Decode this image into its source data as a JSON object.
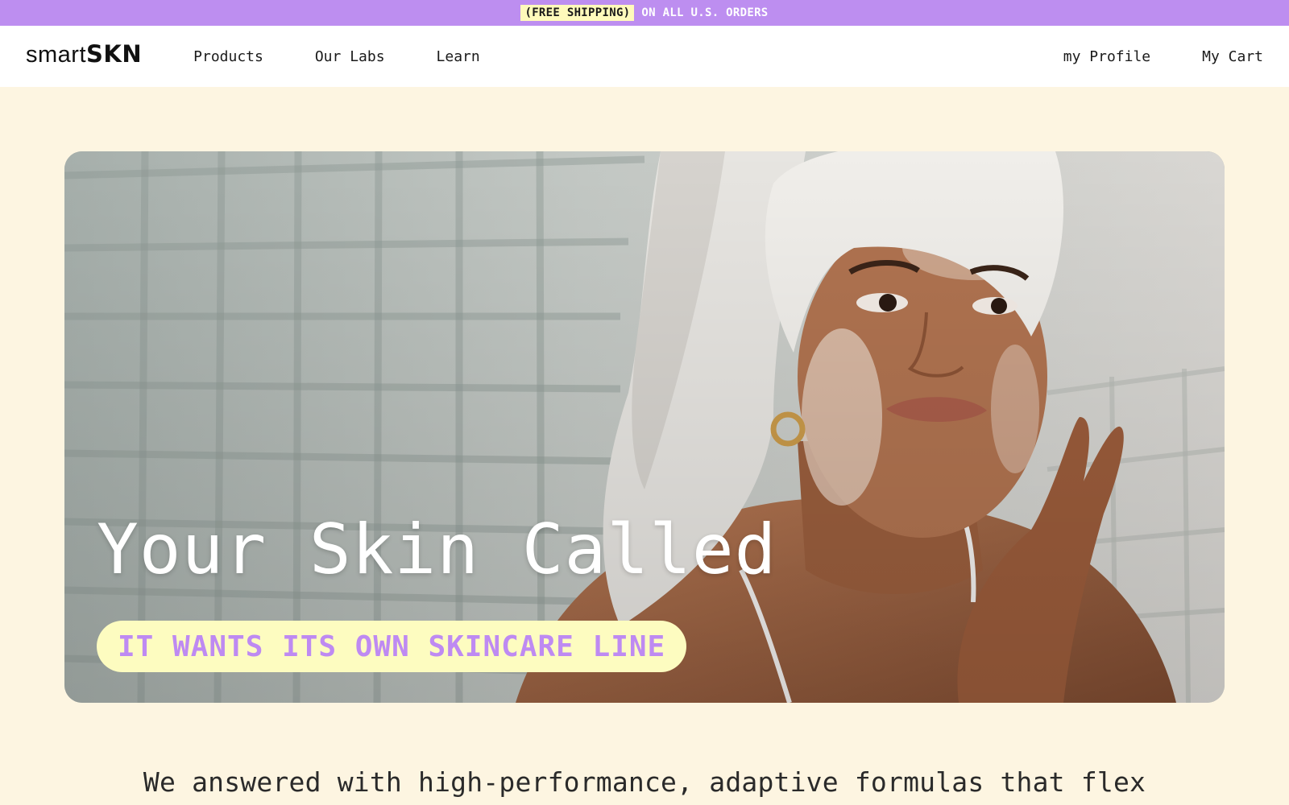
{
  "promo": {
    "highlight": "(FREE SHIPPING)",
    "text": "ON ALL U.S. ORDERS"
  },
  "header": {
    "logo_light": "smart",
    "logo_bold": "SKN",
    "nav": [
      "Products",
      "Our Labs",
      "Learn"
    ],
    "profile_label": "my Profile",
    "cart_label": "My Cart"
  },
  "hero": {
    "headline": "Your Skin Called",
    "pill_text": "IT WANTS ITS OWN SKINCARE LINE"
  },
  "intro": {
    "text": "We answered with high-performance, adaptive formulas that flex"
  },
  "colors": {
    "promo_bg": "#bd8ef0",
    "promo_highlight": "#fffabb",
    "page_bg": "#fdf5e1",
    "pill_bg": "#fdfcc0",
    "pill_text": "#be8af2"
  }
}
